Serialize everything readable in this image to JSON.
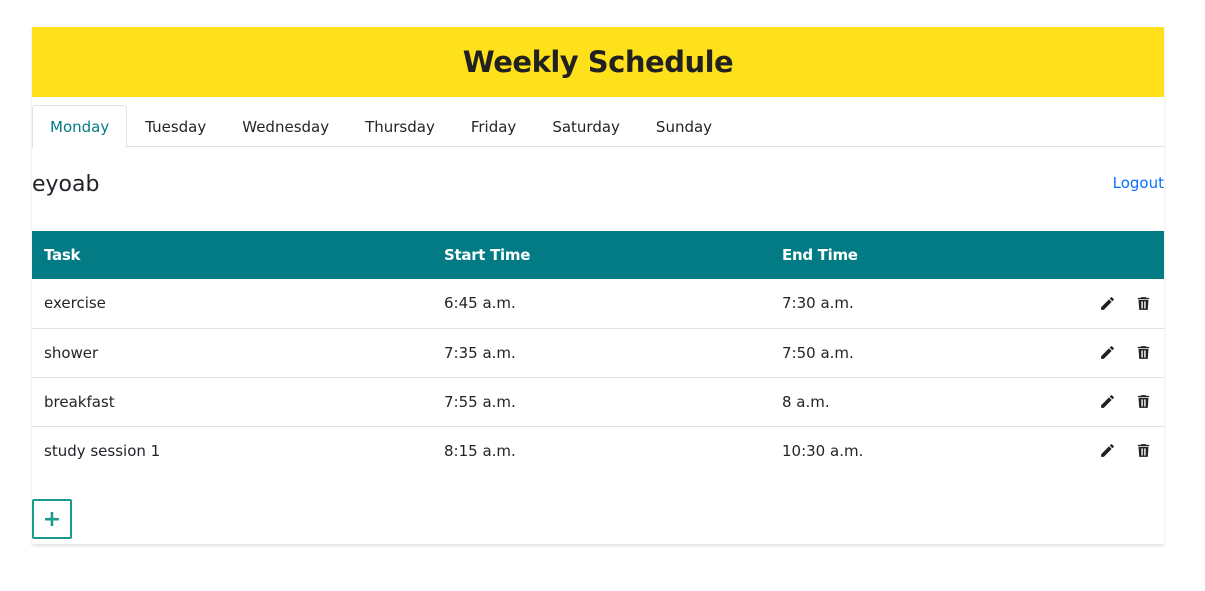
{
  "header": {
    "title": "Weekly Schedule"
  },
  "tabs": [
    {
      "label": "Monday",
      "active": true
    },
    {
      "label": "Tuesday"
    },
    {
      "label": "Wednesday"
    },
    {
      "label": "Thursday"
    },
    {
      "label": "Friday"
    },
    {
      "label": "Saturday"
    },
    {
      "label": "Sunday"
    }
  ],
  "user": {
    "name": "eyoab",
    "logout_label": "Logout"
  },
  "table": {
    "columns": [
      "Task",
      "Start Time",
      "End Time"
    ],
    "rows": [
      {
        "task": "exercise",
        "start": "6:45 a.m.",
        "end": "7:30 a.m."
      },
      {
        "task": "shower",
        "start": "7:35 a.m.",
        "end": "7:50 a.m."
      },
      {
        "task": "breakfast",
        "start": "7:55 a.m.",
        "end": "8 a.m."
      },
      {
        "task": "study session 1",
        "start": "8:15 a.m.",
        "end": "10:30 a.m."
      }
    ],
    "row_actions": [
      "pencil-icon",
      "trash-icon"
    ]
  },
  "add_button": {
    "label": "+"
  },
  "colors": {
    "banner": "#ffe11b",
    "table_header": "#027b85",
    "active_tab": "#027b85",
    "link": "#0d6efd",
    "add_button": "#1a9a8f"
  }
}
